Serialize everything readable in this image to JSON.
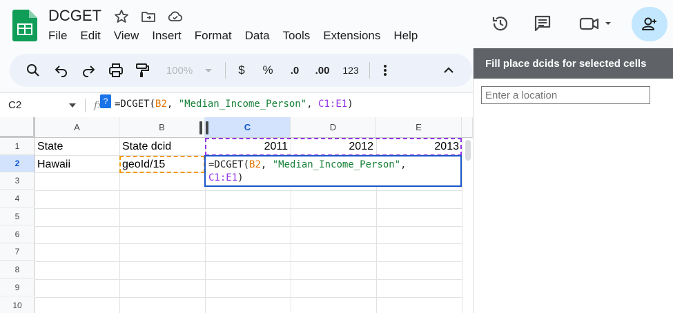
{
  "app": {
    "doc_title": "DCGET",
    "menu": [
      "File",
      "Edit",
      "View",
      "Insert",
      "Format",
      "Data",
      "Tools",
      "Extensions",
      "Help"
    ]
  },
  "toolbar": {
    "zoom": "100%",
    "currency": "$",
    "percent": "%",
    "dec_decrease": ".0",
    "dec_increase": ".00",
    "number_format": "123"
  },
  "formula_bar": {
    "name_box": "C2",
    "fx": "fx",
    "help_badge": "?",
    "formula_parts": [
      {
        "text": "=DCGET(",
        "color": "#1f1f1f"
      },
      {
        "text": "B2",
        "color": "#e37400"
      },
      {
        "text": ", ",
        "color": "#1f1f1f"
      },
      {
        "text": "\"Median_Income_Person\"",
        "color": "#188038"
      },
      {
        "text": ", ",
        "color": "#1f1f1f"
      },
      {
        "text": "C1:E1",
        "color": "#9334e6"
      },
      {
        "text": ")",
        "color": "#1f1f1f"
      }
    ]
  },
  "grid": {
    "columns": [
      "A",
      "B",
      "C",
      "D",
      "E"
    ],
    "rows": [
      "1",
      "2",
      "3",
      "4",
      "5",
      "6",
      "7",
      "8",
      "9",
      "10"
    ],
    "cells": {
      "A1": "State",
      "B1": "State dcid",
      "C1": "2011",
      "D1": "2012",
      "E1": "2013",
      "A2": "Hawaii",
      "B2": "geoId/15"
    },
    "editor": {
      "line1_a": "=DCGET(",
      "line1_b": "B2",
      "line1_c": ", ",
      "line1_d": "\"Median_Income_Person\"",
      "line1_e": ",",
      "line2_a": "C1:E1",
      "line2_b": ")"
    }
  },
  "side_panel": {
    "title": "Fill place dcids for selected cells",
    "input_placeholder": "Enter a location"
  }
}
